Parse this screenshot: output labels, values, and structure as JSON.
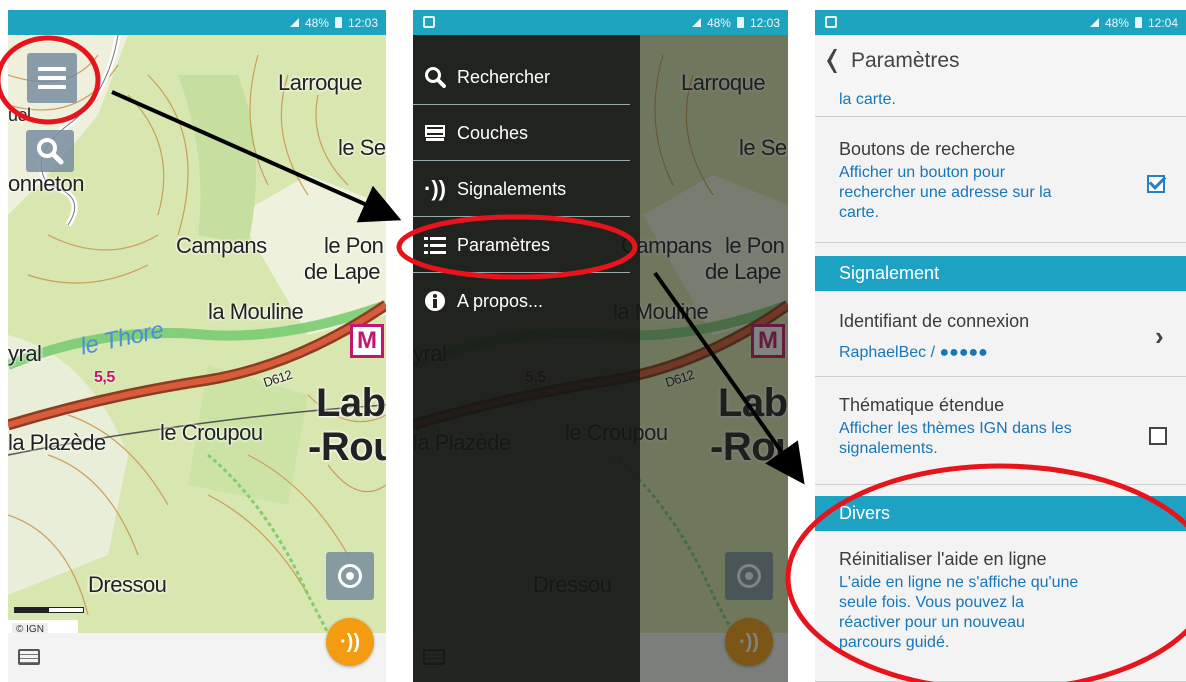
{
  "status": {
    "battery": "48%",
    "time_1": "12:03",
    "time_2": "12:03",
    "time_3": "12:04"
  },
  "map": {
    "labels": {
      "larroque": "Larroque",
      "le_se": "le Se",
      "bonneton": "onneton",
      "campans": "Campans",
      "le_pon": "le Pon",
      "de_lape": "de Lape",
      "la_mouline": "la Mouline",
      "le_thore": "le Thore",
      "yral": "yral",
      "road_55": "5,5",
      "d612": "D612",
      "laba": "Laba",
      "rou": "-Rou",
      "la_plazede": "la Plazède",
      "le_croupou": "le Croupou",
      "dressou": "Dressou",
      "uel": "uel",
      "metro_letter": "M"
    },
    "ign_badge": "© IGN"
  },
  "drawer": {
    "items": [
      {
        "label": "Rechercher",
        "icon": "search-icon"
      },
      {
        "label": "Couches",
        "icon": "layers-icon"
      },
      {
        "label": "Signalements",
        "icon": "signal-icon"
      },
      {
        "label": "Paramètres",
        "icon": "list-icon"
      },
      {
        "label": "A propos...",
        "icon": "info-icon"
      }
    ]
  },
  "settings": {
    "title": "Paramètres",
    "top_snippet": "la carte.",
    "search_buttons": {
      "title": "Boutons de recherche",
      "desc_1": "Afficher un bouton pour",
      "desc_2": "rechercher une adresse sur la",
      "desc_3": "carte.",
      "checked": true
    },
    "section_signalement": "Signalement",
    "login": {
      "title": "Identifiant de connexion",
      "value": "RaphaelBec / ●●●●●"
    },
    "extended": {
      "title": "Thématique étendue",
      "desc_1": "Afficher les thèmes IGN dans les",
      "desc_2": "signalements.",
      "checked": false
    },
    "section_divers": "Divers",
    "reset_help": {
      "title": "Réinitialiser l'aide en ligne",
      "desc_1": "L'aide en ligne ne s'affiche qu'une",
      "desc_2": "seule fois. Vous pouvez la",
      "desc_3": "réactiver pour un nouveau",
      "desc_4": "parcours guidé."
    }
  },
  "colors": {
    "status_bar": "#1fa4bf",
    "section_header": "#1ea2c4",
    "link_text": "#1676b8",
    "annotation_red": "#e8141c",
    "report_button": "#f39c12"
  }
}
